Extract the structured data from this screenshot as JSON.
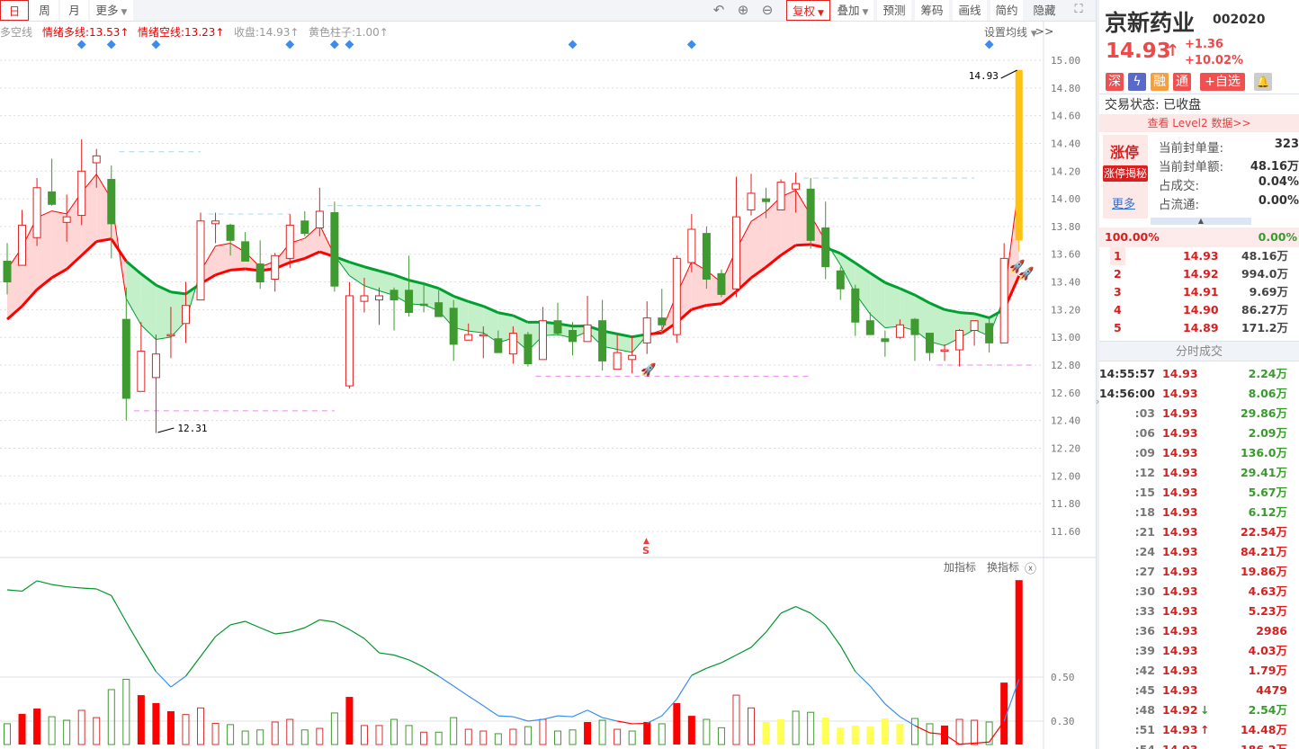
{
  "toolbar": {
    "periods": [
      "日",
      "周",
      "月"
    ],
    "more": "更多",
    "fq": "复权",
    "overlay": "叠加",
    "predict": "预测",
    "chips": "筹码",
    "draw": "画线",
    "simple": "简约",
    "hide": "隐藏>>"
  },
  "legend": {
    "name": "多空线",
    "fast": "情绪多线:13.53↑",
    "slow": "情绪空线:13.23↑",
    "close": "收盘:14.93↑",
    "yellow": "黄色柱子:1.00↑",
    "set_ma": "设置均线"
  },
  "lower": {
    "add": "加指标",
    "swap": "换指标"
  },
  "annotations": {
    "low": "12.31",
    "high": "14.93",
    "signal": "S"
  },
  "colors": {
    "up": "#e02020",
    "down": "#3f9a30",
    "fastFillUp": "#ffd6d6",
    "fastFillDown": "#c3f0c8",
    "slowUp": "#ff0000",
    "slowDown": "#00a030",
    "yellow": "#ffc20e",
    "volYellow": "#ffff55"
  },
  "chart_data": [
    {
      "type": "candlestick",
      "title": "京新药业 日K",
      "ylim": [
        11.41,
        15.28
      ],
      "yticks": [
        "15.00",
        "14.80",
        "14.60",
        "14.40",
        "14.20",
        "14.00",
        "13.80",
        "13.60",
        "13.40",
        "13.20",
        "13.00",
        "12.80",
        "12.60",
        "12.40",
        "12.20",
        "12.00",
        "11.80",
        "11.60"
      ],
      "candles": [
        [
          13.55,
          13.4,
          13.68,
          13.31
        ],
        [
          13.52,
          13.81,
          13.92,
          13.52
        ],
        [
          13.72,
          14.08,
          14.15,
          13.66
        ],
        [
          14.05,
          13.96,
          14.29,
          13.95
        ],
        [
          13.83,
          13.87,
          14.03,
          13.69
        ],
        [
          13.88,
          14.2,
          14.43,
          13.81
        ],
        [
          14.26,
          14.31,
          14.36,
          14.08
        ],
        [
          14.14,
          13.82,
          14.24,
          13.57
        ],
        [
          13.13,
          12.56,
          13.36,
          12.4
        ],
        [
          12.61,
          12.9,
          13.11,
          12.61
        ],
        [
          12.71,
          12.88,
          13.02,
          12.31
        ],
        [
          13.01,
          13.02,
          13.22,
          12.85
        ],
        [
          13.1,
          13.23,
          13.4,
          12.96
        ],
        [
          13.27,
          13.84,
          13.9,
          13.27
        ],
        [
          13.82,
          13.84,
          13.9,
          13.68
        ],
        [
          13.81,
          13.7,
          13.82,
          13.59
        ],
        [
          13.69,
          13.55,
          13.76,
          13.55
        ],
        [
          13.53,
          13.4,
          13.7,
          13.35
        ],
        [
          13.42,
          13.59,
          13.61,
          13.33
        ],
        [
          13.57,
          13.81,
          13.89,
          13.5
        ],
        [
          13.84,
          13.75,
          13.91,
          13.73
        ],
        [
          13.79,
          13.91,
          14.08,
          13.73
        ],
        [
          13.9,
          13.37,
          13.98,
          13.33
        ],
        [
          12.65,
          13.3,
          13.4,
          12.63
        ],
        [
          13.26,
          13.3,
          13.43,
          13.18
        ],
        [
          13.27,
          13.3,
          13.36,
          13.09
        ],
        [
          13.34,
          13.27,
          13.36,
          13.05
        ],
        [
          13.34,
          13.18,
          13.59,
          13.15
        ],
        [
          13.24,
          13.23,
          13.39,
          13.18
        ],
        [
          13.25,
          13.15,
          13.34,
          13.15
        ],
        [
          13.21,
          12.95,
          13.27,
          12.83
        ],
        [
          12.98,
          13.02,
          13.1,
          12.98
        ],
        [
          13.01,
          13.02,
          13.08,
          12.85
        ],
        [
          12.99,
          12.89,
          13.05,
          12.89
        ],
        [
          12.88,
          13.03,
          13.08,
          12.81
        ],
        [
          13.02,
          12.81,
          13.04,
          12.79
        ],
        [
          12.84,
          13.12,
          13.22,
          12.84
        ],
        [
          13.12,
          13.03,
          13.25,
          13.01
        ],
        [
          13.05,
          12.97,
          13.11,
          12.87
        ],
        [
          12.97,
          13.09,
          13.3,
          12.97
        ],
        [
          13.12,
          12.83,
          13.27,
          12.76
        ],
        [
          12.77,
          12.89,
          13.02,
          12.77
        ],
        [
          12.84,
          12.87,
          13.01,
          12.74
        ],
        [
          12.96,
          13.14,
          13.26,
          12.88
        ],
        [
          13.14,
          13.09,
          13.35,
          13.03
        ],
        [
          13.02,
          13.57,
          13.59,
          12.96
        ],
        [
          13.54,
          13.78,
          13.89,
          13.47
        ],
        [
          13.75,
          13.42,
          13.8,
          13.35
        ],
        [
          13.46,
          13.31,
          13.49,
          13.29
        ],
        [
          13.35,
          13.87,
          14.16,
          13.29
        ],
        [
          13.92,
          14.04,
          14.18,
          13.88
        ],
        [
          14.0,
          13.98,
          14.08,
          13.86
        ],
        [
          13.92,
          14.12,
          14.14,
          13.92
        ],
        [
          14.07,
          14.11,
          14.19,
          13.9
        ],
        [
          14.07,
          13.7,
          14.15,
          13.64
        ],
        [
          13.79,
          13.51,
          13.98,
          13.42
        ],
        [
          13.48,
          13.35,
          13.51,
          13.27
        ],
        [
          13.35,
          13.11,
          13.38,
          13.01
        ],
        [
          13.12,
          13.02,
          13.18,
          13.02
        ],
        [
          12.99,
          12.97,
          13.05,
          12.86
        ],
        [
          13.0,
          13.09,
          13.13,
          12.99
        ],
        [
          13.13,
          13.02,
          13.14,
          12.83
        ],
        [
          13.03,
          12.89,
          13.03,
          12.83
        ],
        [
          12.9,
          12.91,
          12.95,
          12.83
        ],
        [
          12.91,
          13.05,
          13.06,
          12.79
        ],
        [
          13.05,
          13.12,
          13.12,
          12.94
        ],
        [
          13.1,
          12.96,
          13.14,
          12.89
        ],
        [
          12.96,
          13.57,
          13.68,
          12.96
        ],
        [
          13.7,
          14.93,
          14.93,
          13.62
        ]
      ],
      "yellow_column_index": 68,
      "signal_markers": [
        5,
        7,
        10,
        19,
        22,
        23,
        38,
        46,
        66
      ],
      "levels": [
        {
          "price": 14.34,
          "from": 8,
          "to": 13,
          "kind": "resistance"
        },
        {
          "price": 13.89,
          "from": 14,
          "to": 19,
          "kind": "resistance"
        },
        {
          "price": 13.95,
          "from": 22,
          "to": 36,
          "kind": "resistance"
        },
        {
          "price": 14.15,
          "from": 54,
          "to": 65,
          "kind": "resistance"
        },
        {
          "price": 12.47,
          "from": 9,
          "to": 22,
          "kind": "support"
        },
        {
          "price": 12.72,
          "from": 36,
          "to": 54,
          "kind": "support"
        },
        {
          "price": 12.8,
          "from": 63,
          "to": 69,
          "kind": "support"
        }
      ],
      "low_point": {
        "index": 10,
        "value": 12.31
      },
      "high_point": {
        "index": 68,
        "value": 14.93
      }
    },
    {
      "type": "bar+line",
      "title": "指标",
      "ylim": [
        0.194,
        1.035
      ],
      "yticks": [
        "0.50",
        "0.30"
      ],
      "bars": [
        [
          0.288,
          "gh"
        ],
        [
          0.333,
          "rf"
        ],
        [
          0.357,
          "rf"
        ],
        [
          0.32,
          "gh"
        ],
        [
          0.304,
          "gh"
        ],
        [
          0.349,
          "rh"
        ],
        [
          0.316,
          "rh"
        ],
        [
          0.443,
          "gh"
        ],
        [
          0.49,
          "gh"
        ],
        [
          0.418,
          "rf"
        ],
        [
          0.382,
          "rf"
        ],
        [
          0.345,
          "rf"
        ],
        [
          0.33,
          "rh"
        ],
        [
          0.36,
          "rh"
        ],
        [
          0.29,
          "rh"
        ],
        [
          0.284,
          "gh"
        ],
        [
          0.255,
          "gh"
        ],
        [
          0.26,
          "gh"
        ],
        [
          0.296,
          "rh"
        ],
        [
          0.308,
          "rh"
        ],
        [
          0.26,
          "gh"
        ],
        [
          0.267,
          "rh"
        ],
        [
          0.337,
          "gh"
        ],
        [
          0.41,
          "rf"
        ],
        [
          0.28,
          "rh"
        ],
        [
          0.28,
          "rh"
        ],
        [
          0.308,
          "gh"
        ],
        [
          0.28,
          "gh"
        ],
        [
          0.25,
          "rh"
        ],
        [
          0.25,
          "gh"
        ],
        [
          0.316,
          "gh"
        ],
        [
          0.263,
          "rh"
        ],
        [
          0.255,
          "rh"
        ],
        [
          0.243,
          "gh"
        ],
        [
          0.263,
          "rh"
        ],
        [
          0.275,
          "gh"
        ],
        [
          0.308,
          "rh"
        ],
        [
          0.255,
          "gh"
        ],
        [
          0.26,
          "gh"
        ],
        [
          0.296,
          "rf"
        ],
        [
          0.304,
          "gh"
        ],
        [
          0.263,
          "rh"
        ],
        [
          0.255,
          "gh"
        ],
        [
          0.296,
          "rf"
        ],
        [
          0.288,
          "gh"
        ],
        [
          0.382,
          "rf"
        ],
        [
          0.324,
          "rf"
        ],
        [
          0.308,
          "gh"
        ],
        [
          0.27,
          "gh"
        ],
        [
          0.418,
          "rh"
        ],
        [
          0.36,
          "rh"
        ],
        [
          0.296,
          "y"
        ],
        [
          0.308,
          "y"
        ],
        [
          0.345,
          "gh"
        ],
        [
          0.34,
          "gh"
        ],
        [
          0.316,
          "y"
        ],
        [
          0.27,
          "y"
        ],
        [
          0.28,
          "y"
        ],
        [
          0.275,
          "y"
        ],
        [
          0.312,
          "y"
        ],
        [
          0.288,
          "y"
        ],
        [
          0.312,
          "gh"
        ],
        [
          0.288,
          "gh"
        ],
        [
          0.28,
          "rf"
        ],
        [
          0.308,
          "rh"
        ],
        [
          0.304,
          "rh"
        ],
        [
          0.296,
          "gh"
        ],
        [
          0.475,
          "rf"
        ],
        [
          0.94,
          "rf"
        ]
      ],
      "line": [
        0.896,
        0.89,
        0.937,
        0.92,
        0.91,
        0.904,
        0.9,
        0.87,
        0.75,
        0.635,
        0.525,
        0.455,
        0.504,
        0.594,
        0.684,
        0.737,
        0.753,
        0.724,
        0.696,
        0.704,
        0.724,
        0.76,
        0.75,
        0.716,
        0.675,
        0.61,
        0.6,
        0.578,
        0.545,
        0.504,
        0.459,
        0.414,
        0.37,
        0.324,
        0.32,
        0.3,
        0.308,
        0.324,
        0.32,
        0.35,
        0.316,
        0.3,
        0.288,
        0.29,
        0.324,
        0.4,
        0.508,
        0.54,
        0.565,
        0.6,
        0.635,
        0.704,
        0.79,
        0.82,
        0.79,
        0.737,
        0.643,
        0.525,
        0.459,
        0.378,
        0.32,
        0.28,
        0.247,
        0.24,
        0.195,
        0.2,
        0.205,
        0.3,
        0.49
      ]
    }
  ],
  "stock": {
    "name": "京新药业",
    "code": "002020",
    "price": "14.93",
    "arrow": "↑",
    "change": "+1.36",
    "pct": "+10.02%",
    "badges": [
      "深",
      "融",
      "通"
    ],
    "add": "+自选",
    "status": "交易状态: 已收盘",
    "level2": "查看 Level2 数据>>"
  },
  "limit": {
    "title": "涨停",
    "reveal": "涨停揭秘",
    "more": "更多",
    "rows": [
      {
        "label": "当前封单量:",
        "value": "323"
      },
      {
        "label": "当前封单额:",
        "value": "48.16万"
      },
      {
        "label": "占成交:",
        "value": "0.04%"
      },
      {
        "label": "占流通:",
        "value": "0.00%"
      }
    ],
    "ratio_left": "100.00%",
    "ratio_right": "0.00%"
  },
  "orders": [
    {
      "n": "1",
      "p": "14.93",
      "v": "48.16万"
    },
    {
      "n": "2",
      "p": "14.92",
      "v": "994.0万"
    },
    {
      "n": "3",
      "p": "14.91",
      "v": "9.69万"
    },
    {
      "n": "4",
      "p": "14.90",
      "v": "86.27万"
    },
    {
      "n": "5",
      "p": "14.89",
      "v": "171.2万"
    }
  ],
  "trades_title": "分时成交",
  "trades": [
    {
      "t": "14:55:57",
      "p": "14.93",
      "a": "",
      "v": "2.24万",
      "c": "g"
    },
    {
      "t": "14:56:00",
      "p": "14.93",
      "a": "",
      "v": "8.06万",
      "c": "g"
    },
    {
      "t": ":03",
      "p": "14.93",
      "a": "",
      "v": "29.86万",
      "c": "g"
    },
    {
      "t": ":06",
      "p": "14.93",
      "a": "",
      "v": "2.09万",
      "c": "g"
    },
    {
      "t": ":09",
      "p": "14.93",
      "a": "",
      "v": "136.0万",
      "c": "g"
    },
    {
      "t": ":12",
      "p": "14.93",
      "a": "",
      "v": "29.41万",
      "c": "g"
    },
    {
      "t": ":15",
      "p": "14.93",
      "a": "",
      "v": "5.67万",
      "c": "g"
    },
    {
      "t": ":18",
      "p": "14.93",
      "a": "",
      "v": "6.12万",
      "c": "g"
    },
    {
      "t": ":21",
      "p": "14.93",
      "a": "",
      "v": "22.54万",
      "c": "r"
    },
    {
      "t": ":24",
      "p": "14.93",
      "a": "",
      "v": "84.21万",
      "c": "r"
    },
    {
      "t": ":27",
      "p": "14.93",
      "a": "",
      "v": "19.86万",
      "c": "r"
    },
    {
      "t": ":30",
      "p": "14.93",
      "a": "",
      "v": "4.63万",
      "c": "r"
    },
    {
      "t": ":33",
      "p": "14.93",
      "a": "",
      "v": "5.23万",
      "c": "r"
    },
    {
      "t": ":36",
      "p": "14.93",
      "a": "",
      "v": "2986",
      "c": "r"
    },
    {
      "t": ":39",
      "p": "14.93",
      "a": "",
      "v": "4.03万",
      "c": "r"
    },
    {
      "t": ":42",
      "p": "14.93",
      "a": "",
      "v": "1.79万",
      "c": "r"
    },
    {
      "t": ":45",
      "p": "14.93",
      "a": "",
      "v": "4479",
      "c": "r"
    },
    {
      "t": ":48",
      "p": "14.92",
      "a": "↓",
      "v": "2.54万",
      "c": "g"
    },
    {
      "t": ":51",
      "p": "14.93",
      "a": "↑",
      "v": "14.48万",
      "c": "r"
    },
    {
      "t": ":54",
      "p": "14.93",
      "a": "",
      "v": "186.2万",
      "c": "r"
    }
  ]
}
